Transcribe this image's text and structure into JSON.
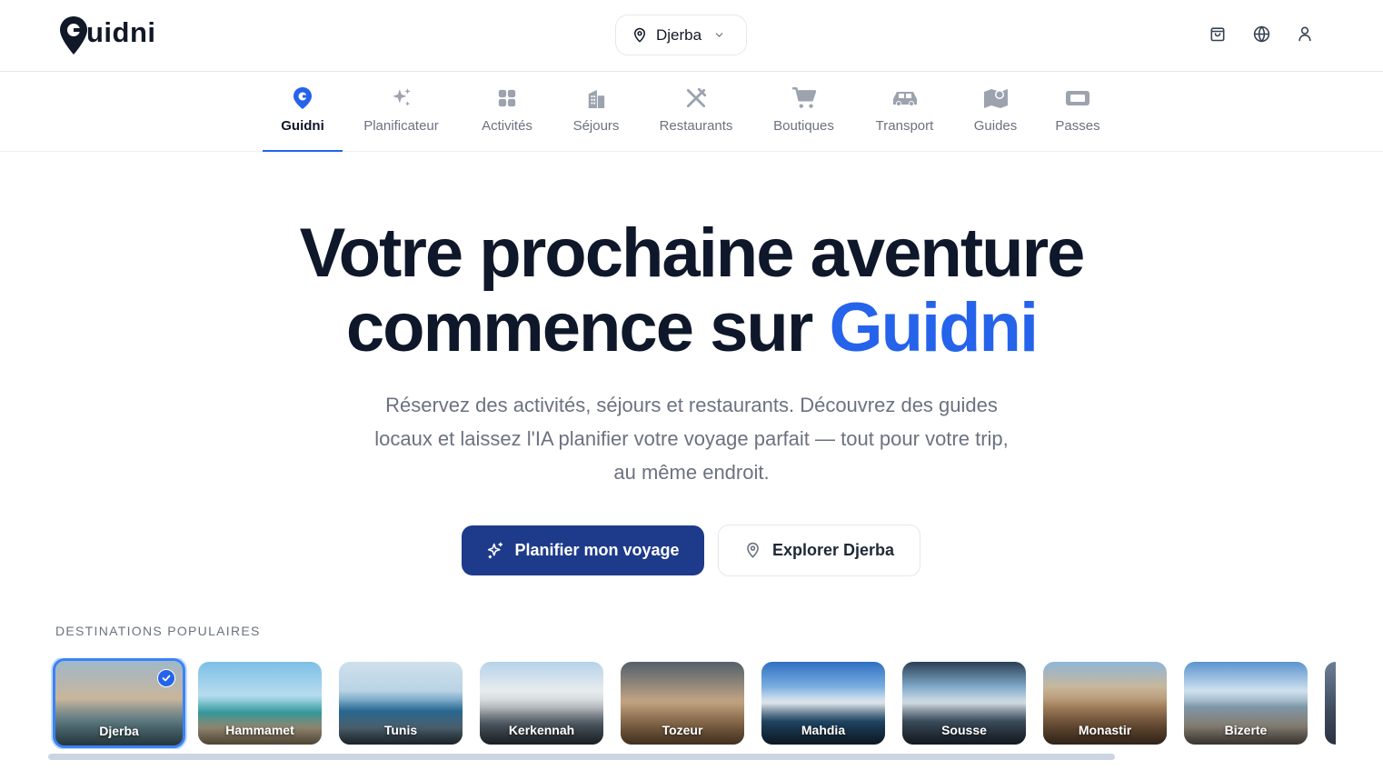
{
  "brand": {
    "name": "uidni",
    "accent": "#2563eb",
    "dark_blue": "#1e3a8a"
  },
  "location": {
    "selected": "Djerba",
    "icon": "map-pin-icon"
  },
  "header_icons": [
    {
      "name": "cart-icon"
    },
    {
      "name": "globe-icon"
    },
    {
      "name": "user-icon"
    }
  ],
  "nav": {
    "items": [
      {
        "label": "Guidni",
        "icon": "guidni-g-icon",
        "active": true
      },
      {
        "label": "Planificateur",
        "icon": "sparkles-icon"
      },
      {
        "label": "Activités",
        "icon": "grid-icon"
      },
      {
        "label": "Séjours",
        "icon": "building-icon"
      },
      {
        "label": "Restaurants",
        "icon": "utensils-icon"
      },
      {
        "label": "Boutiques",
        "icon": "shopping-cart-icon"
      },
      {
        "label": "Transport",
        "icon": "car-icon"
      },
      {
        "label": "Guides",
        "icon": "map-icon"
      },
      {
        "label": "Passes",
        "icon": "ticket-icon"
      }
    ]
  },
  "hero": {
    "title_line1": "Votre prochaine aventure",
    "title_line2_prefix": "commence sur ",
    "title_line2_accent": "Guidni",
    "subtitle": "Réservez des activités, séjours et restaurants. Découvrez des guides locaux et laissez l'IA planifier votre voyage parfait — tout pour votre trip, au même endroit.",
    "primary_button": "Planifier mon voyage",
    "secondary_button": "Explorer Djerba"
  },
  "destinations": {
    "heading": "DESTINATIONS POPULAIRES",
    "items": [
      {
        "name": "Djerba",
        "selected": true
      },
      {
        "name": "Hammamet"
      },
      {
        "name": "Tunis"
      },
      {
        "name": "Kerkennah"
      },
      {
        "name": "Tozeur"
      },
      {
        "name": "Mahdia"
      },
      {
        "name": "Sousse"
      },
      {
        "name": "Monastir"
      },
      {
        "name": "Bizerte"
      }
    ]
  }
}
